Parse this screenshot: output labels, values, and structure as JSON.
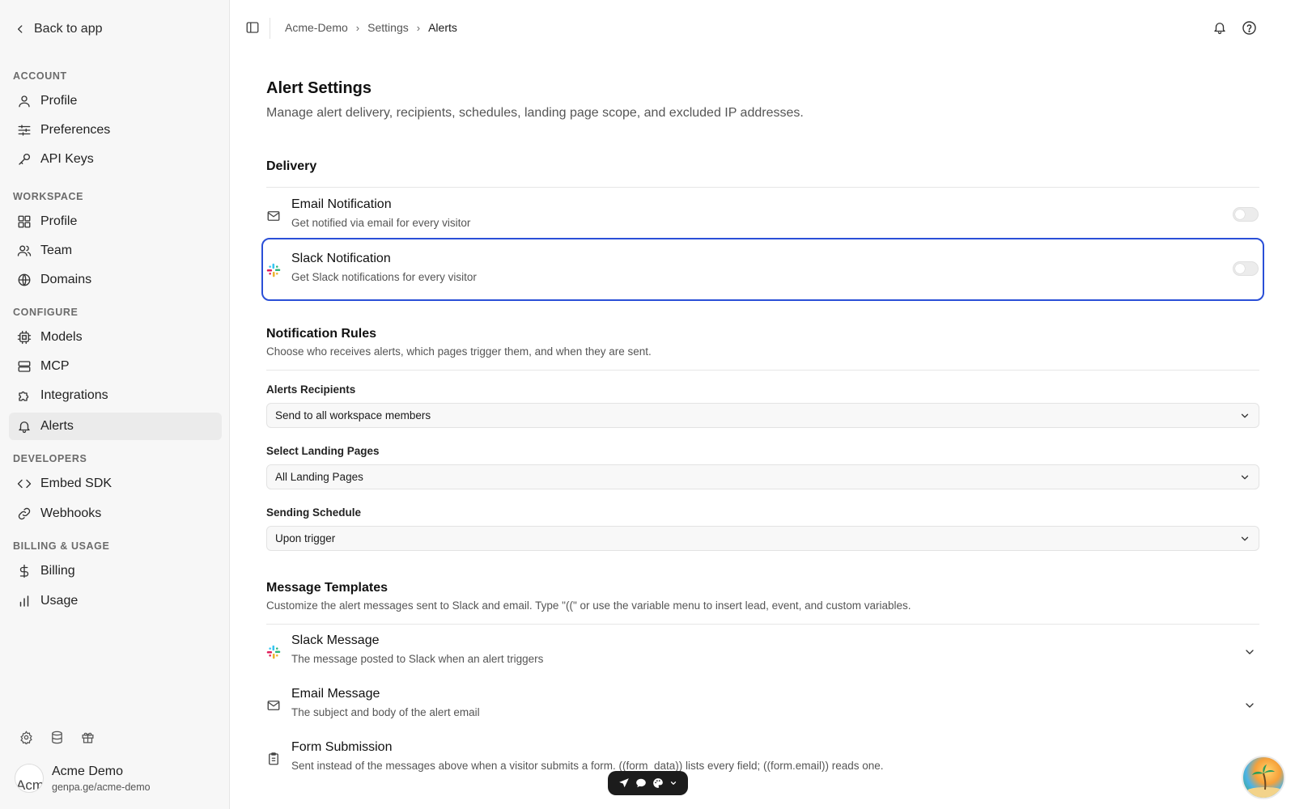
{
  "sidebar": {
    "back_label": "Back to app",
    "sections": {
      "account": "ACCOUNT",
      "workspace": "WORKSPACE",
      "configure": "CONFIGURE",
      "developers": "DEVELOPERS",
      "billing": "BILLING & USAGE"
    },
    "items": {
      "account_profile": "Profile",
      "preferences": "Preferences",
      "api_keys": "API Keys",
      "workspace_profile": "Profile",
      "team": "Team",
      "domains": "Domains",
      "models": "Models",
      "mcp": "MCP",
      "integrations": "Integrations",
      "alerts": "Alerts",
      "embed_sdk": "Embed SDK",
      "webhooks": "Webhooks",
      "billing": "Billing",
      "usage": "Usage"
    },
    "active_item": "alerts",
    "user": {
      "avatar_text": "Acm",
      "name": "Acme Demo",
      "handle": "genpa.ge/acme-demo"
    }
  },
  "breadcrumb": {
    "items": [
      "Acme-Demo",
      "Settings",
      "Alerts"
    ]
  },
  "page": {
    "title": "Alert Settings",
    "subtitle": "Manage alert delivery, recipients, schedules, landing page scope, and excluded IP addresses."
  },
  "delivery": {
    "heading": "Delivery",
    "email": {
      "title": "Email Notification",
      "desc": "Get notified via email for every visitor",
      "enabled": false
    },
    "slack": {
      "title": "Slack Notification",
      "desc": "Get Slack notifications for every visitor",
      "enabled": false
    }
  },
  "rules": {
    "heading": "Notification Rules",
    "desc": "Choose who receives alerts, which pages trigger them, and when they are sent.",
    "recipients": {
      "label": "Alerts Recipients",
      "value": "Send to all workspace members"
    },
    "landing_pages": {
      "label": "Select Landing Pages",
      "value": "All Landing Pages"
    },
    "schedule": {
      "label": "Sending Schedule",
      "value": "Upon trigger"
    }
  },
  "templates": {
    "heading": "Message Templates",
    "desc": "Customize the alert messages sent to Slack and email. Type \"((\" or use the variable menu to insert lead, event, and custom variables.",
    "slack": {
      "title": "Slack Message",
      "desc": "The message posted to Slack when an alert triggers"
    },
    "email": {
      "title": "Email Message",
      "desc": "The subject and body of the alert email"
    },
    "form": {
      "title": "Form Submission",
      "desc": "Sent instead of the messages above when a visitor submits a form. ((form_data)) lists every field; ((form.email)) reads one."
    }
  },
  "colors": {
    "focus": "#2a4fd7",
    "slack_red": "#E01E5A",
    "slack_green": "#2EB67D",
    "slack_blue": "#36C5F0",
    "slack_yellow": "#ECB22E"
  }
}
